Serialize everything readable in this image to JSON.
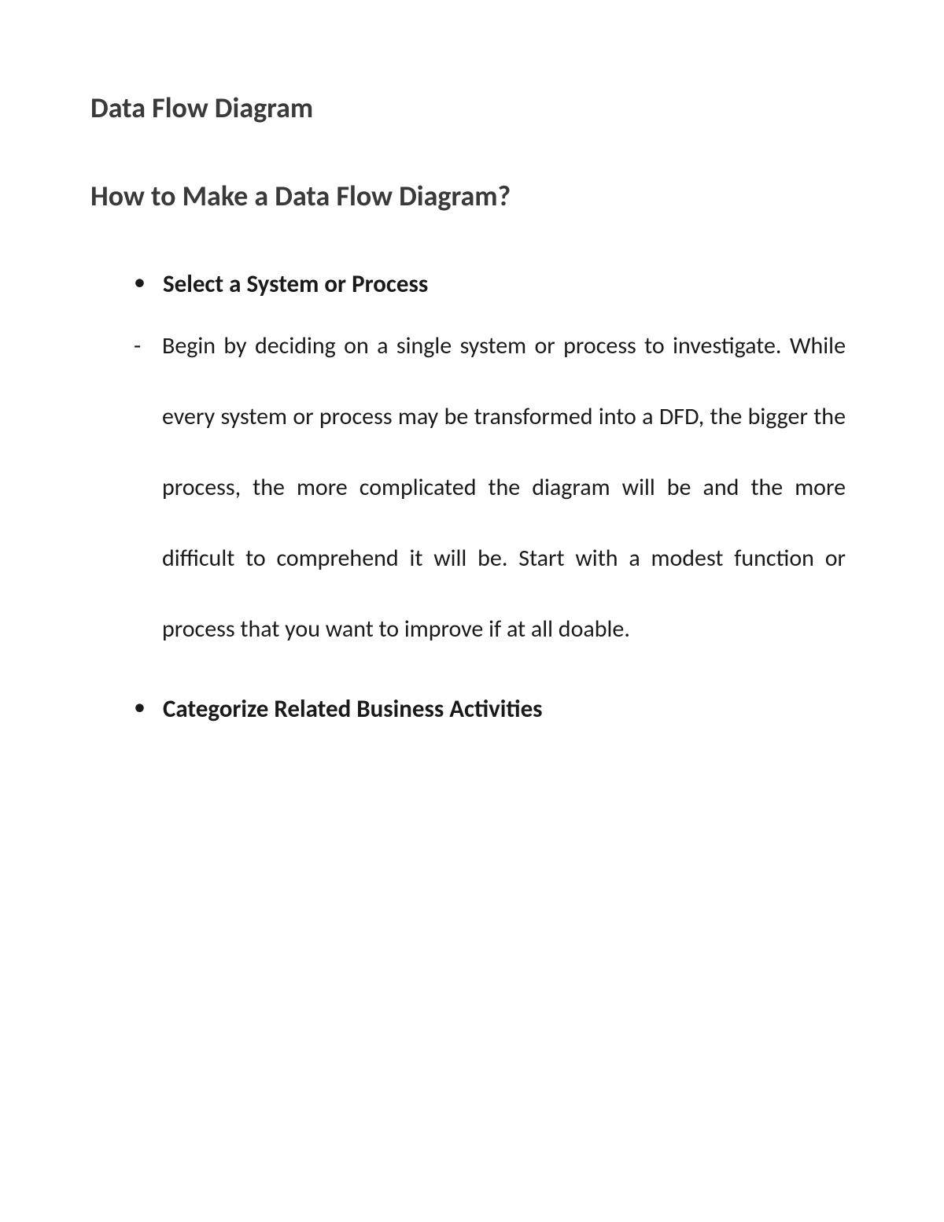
{
  "title": "Data Flow Diagram",
  "subtitle": "How to Make a Data Flow Diagram?",
  "items": [
    {
      "type": "bullet",
      "heading": "Select a System or Process"
    },
    {
      "type": "dash",
      "text": "Begin by deciding on a single system or process to investigate. While every system or process may be transformed into a DFD, the bigger the process, the more complicated the diagram will be and the more difficult to comprehend it will be. Start with a modest function or process that you want to improve if at all doable."
    },
    {
      "type": "bullet",
      "heading": "Categorize Related Business Activities"
    }
  ]
}
